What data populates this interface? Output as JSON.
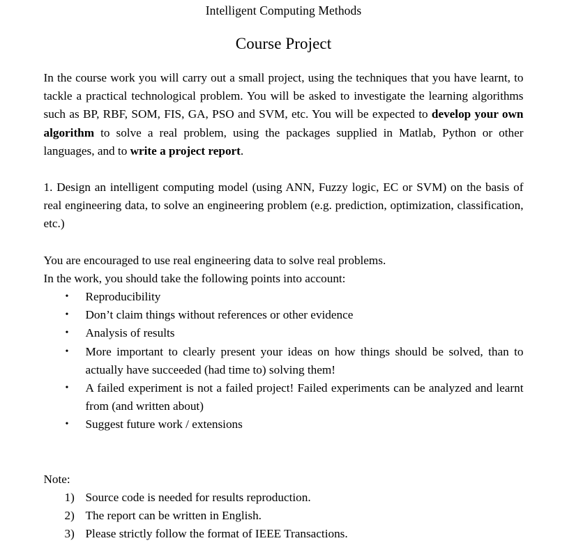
{
  "document": {
    "title": "Intelligent Computing Methods",
    "subtitle": "Course Project",
    "intro": {
      "text_before_bold_1": "In the course work you will carry out a small project, using the techniques that you have learnt, to tackle a practical technological problem. You will be asked to investigate the learning algorithms such as BP, RBF, SOM, FIS, GA, PSO and SVM, etc. You will be expected to ",
      "bold_1": "develop your own algorithm",
      "text_between": " to solve a real problem, using the packages supplied in Matlab, Python or other languages, and to ",
      "bold_2": "write a project report",
      "text_after": "."
    },
    "task_1": "1. Design an intelligent computing model (using ANN, Fuzzy logic, EC or SVM) on the basis of real engineering data, to solve an engineering problem (e.g. prediction, optimization, classification, etc.)",
    "encouragement": "You are encouraged to use real engineering data to solve real problems.",
    "points_lead_in": "In the work, you should take the following points into account:",
    "bullet_marker": "•",
    "bullets": [
      "Reproducibility",
      "Don’t claim things without references or other evidence",
      "Analysis of results",
      "More important to clearly present your ideas on how things should be solved, than to actually have succeeded (had time to) solving them!",
      "A failed experiment is not a failed project! Failed experiments can be analyzed and learnt from (and written about)",
      "Suggest future work / extensions"
    ],
    "note_label": "Note:",
    "notes": [
      {
        "marker": "1)",
        "text": "Source code is needed for results reproduction."
      },
      {
        "marker": "2)",
        "text": "The report can be written in English."
      },
      {
        "marker": "3)",
        "text": "Please strictly follow the format of IEEE Transactions."
      }
    ]
  },
  "colors": {
    "background": "#ffffff",
    "text": "#000000"
  }
}
